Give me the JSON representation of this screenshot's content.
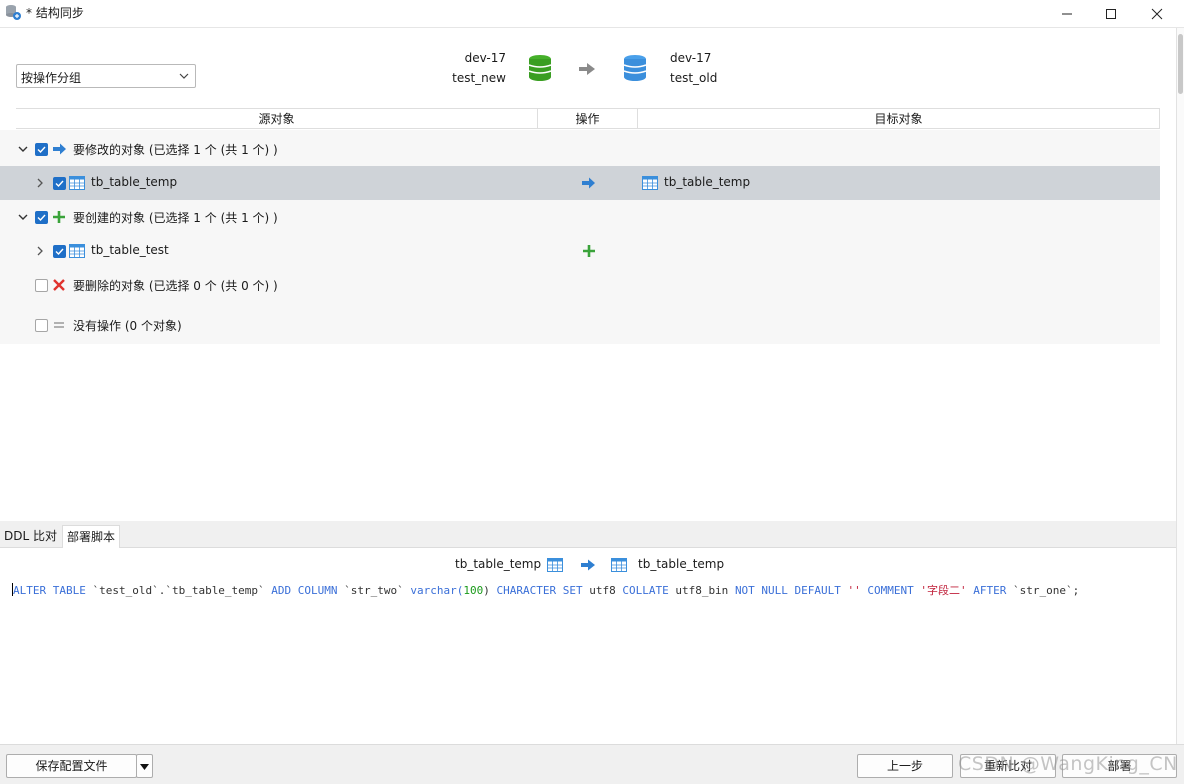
{
  "window": {
    "title": "* 结构同步"
  },
  "header": {
    "group_by": "按操作分组",
    "source": {
      "connection": "dev-17",
      "database": "test_new"
    },
    "target": {
      "connection": "dev-17",
      "database": "test_old"
    }
  },
  "columns": {
    "source": "源对象",
    "operation": "操作",
    "target": "目标对象"
  },
  "groups": {
    "modify": {
      "label": "要修改的对象 (已选择 1 个 (共 1 个) )",
      "item": {
        "name": "tb_table_temp",
        "target": "tb_table_temp"
      }
    },
    "create": {
      "label": "要创建的对象 (已选择 1 个 (共 1 个) )",
      "item": {
        "name": "tb_table_test"
      }
    },
    "delete": {
      "label": "要删除的对象 (已选择 0 个 (共 0 个) )"
    },
    "none": {
      "label": "没有操作 (0 个对象)"
    }
  },
  "tabs": {
    "ddl": "DDL 比对",
    "deploy": "部署脚本"
  },
  "script": {
    "source_table": "tb_table_temp",
    "target_table": "tb_table_temp",
    "sql": {
      "p1": "ALTER TABLE",
      "p2": " `test_old`.`tb_table_temp` ",
      "p3": "ADD COLUMN",
      "p4": " `str_two` ",
      "p5": "varchar(",
      "p6": "100",
      "p7": ") ",
      "p8": "CHARACTER SET",
      "p9": " utf8 ",
      "p10": "COLLATE",
      "p11": " utf8_bin ",
      "p12": "NOT NULL DEFAULT",
      "p13": " '' ",
      "p14": "COMMENT",
      "p15": " '字段二' ",
      "p16": "AFTER",
      "p17": " `str_one`;"
    }
  },
  "footer": {
    "save_config": "保存配置文件",
    "prev": "上一步",
    "recompare": "重新比对",
    "deploy": "部署",
    "watermark": "CSDN @WangKing_CN"
  },
  "colors": {
    "selected_row": "#cfd3d8",
    "checkbox": "#1f6fc7",
    "arrow": "#2f7fd1",
    "add": "#3aa33a",
    "delete": "#e0322d"
  }
}
